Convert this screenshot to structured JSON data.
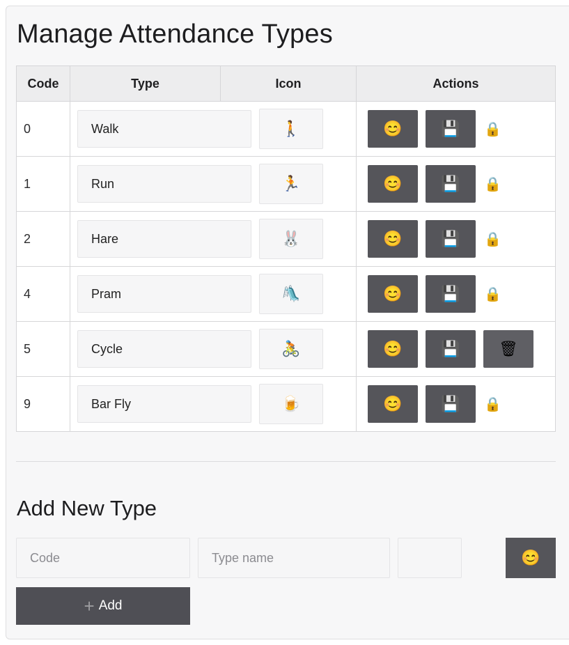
{
  "title": "Manage Attendance Types",
  "table": {
    "headers": {
      "code": "Code",
      "type": "Type",
      "icon": "Icon",
      "actions": "Actions"
    },
    "rows": [
      {
        "code": "0",
        "type": "Walk",
        "icon": "🚶",
        "emoji_button": "😊",
        "save_button": "💾",
        "status": "🔒"
      },
      {
        "code": "1",
        "type": "Run",
        "icon": "🏃",
        "emoji_button": "😊",
        "save_button": "💾",
        "status": "🔒"
      },
      {
        "code": "2",
        "type": "Hare",
        "icon": "🐰",
        "emoji_button": "😊",
        "save_button": "💾",
        "status": "🔒"
      },
      {
        "code": "4",
        "type": "Pram",
        "icon": "🛝",
        "emoji_button": "😊",
        "save_button": "💾",
        "status": "🔒"
      },
      {
        "code": "5",
        "type": "Cycle",
        "icon": "🚴",
        "emoji_button": "😊",
        "save_button": "💾",
        "delete_button": "🗑"
      },
      {
        "code": "9",
        "type": "Bar Fly",
        "icon": "🍺",
        "emoji_button": "😊",
        "save_button": "💾",
        "status": "🔒"
      }
    ]
  },
  "add_section": {
    "heading": "Add New Type",
    "code_placeholder": "Code",
    "type_placeholder": "Type name",
    "emoji_button": "😊",
    "add_icon": "+",
    "add_label": "Add"
  },
  "icons": {
    "emoji_picker": "smiley-icon",
    "save": "floppy-disk-icon",
    "locked": "lock-icon",
    "delete": "trash-icon"
  },
  "colors": {
    "button_bg": "#55555a",
    "panel_bg": "#f7f7f8",
    "header_bg": "#ededee"
  }
}
